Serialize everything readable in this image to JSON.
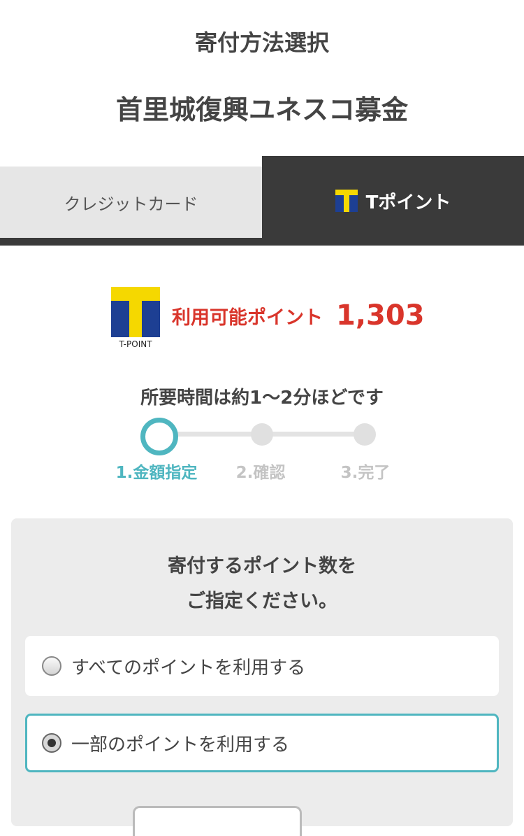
{
  "header": {
    "title": "寄付方法選択",
    "fund_name": "首里城復興ユネスコ募金"
  },
  "tabs": [
    {
      "label": "クレジットカード",
      "active": false
    },
    {
      "label": "Tポイント",
      "active": true,
      "icon": "tpoint-icon"
    }
  ],
  "points": {
    "logo_text": "T-POINT",
    "label": "利用可能ポイント",
    "value": "1,303"
  },
  "steps": {
    "duration_text": "所要時間は約1〜2分ほどです",
    "items": [
      {
        "label": "1.金額指定",
        "active": true
      },
      {
        "label": "2.確認",
        "active": false
      },
      {
        "label": "3.完了",
        "active": false
      }
    ]
  },
  "form": {
    "title_line1": "寄付するポイント数を",
    "title_line2": "ご指定ください。",
    "options": [
      {
        "label": "すべてのポイントを利用する",
        "selected": false
      },
      {
        "label": "一部のポイントを利用する",
        "selected": true
      }
    ]
  },
  "colors": {
    "accent": "#4fb6c0",
    "points_red": "#d9352b",
    "tab_dark": "#3a3a3a",
    "tpoint_yellow": "#f5d800",
    "tpoint_blue": "#1d3f93"
  }
}
